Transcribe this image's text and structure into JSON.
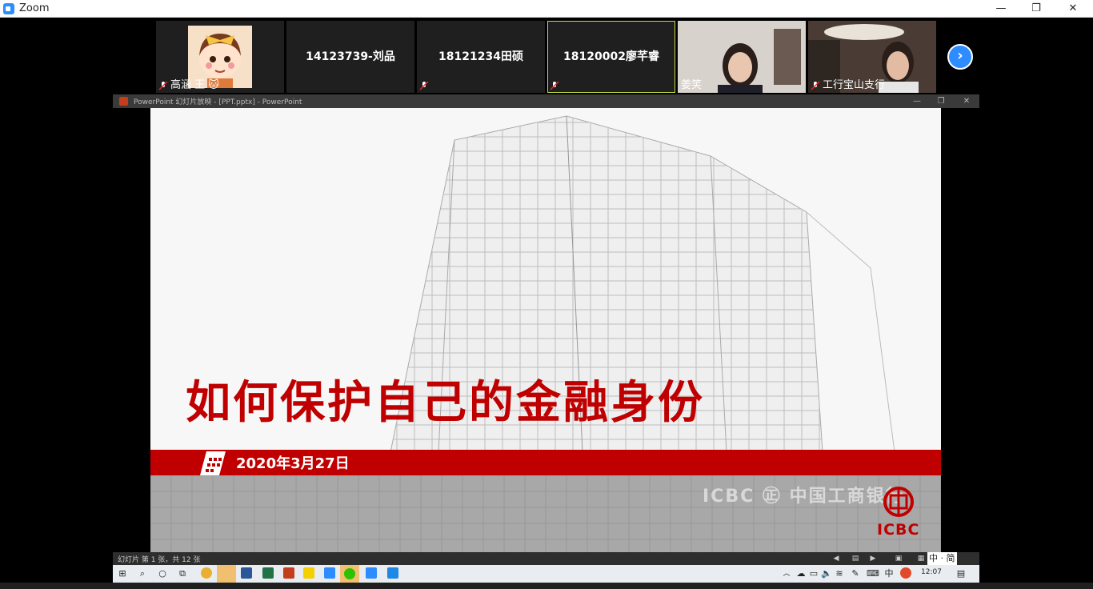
{
  "zoom": {
    "title": "Zoom",
    "min": "—",
    "restore": "❐",
    "close": "✕"
  },
  "gallery": {
    "tiles": [
      {
        "name": "",
        "label": "高涵 王 🐱",
        "muted": true
      },
      {
        "name": "14123739-刘品",
        "label": "",
        "muted": false
      },
      {
        "name": "18121234田硕",
        "label": "",
        "muted": true
      },
      {
        "name": "18120002廖芊睿",
        "label": "",
        "muted": true
      },
      {
        "name": "",
        "label": "姜笑",
        "muted": false
      },
      {
        "name": "",
        "label": "工行宝山支行",
        "muted": true
      }
    ],
    "next": "›"
  },
  "ppt": {
    "window_title": "PowerPoint 幻灯片放映 - [PPT.pptx] - PowerPoint",
    "ctl_min": "—",
    "ctl_restore": "❐",
    "ctl_close": "✕",
    "status": "幻灯片 第 1 张，共 12 张"
  },
  "slide": {
    "title": "如何保护自己的金融身份",
    "date": "2020年3月27日",
    "logo_text": "ICBC",
    "building_sign": "ICBC ㊣ 中国工商银行"
  },
  "taskbar": {
    "ime": "中",
    "time": "12:07",
    "ime2": "中 · 简"
  },
  "colors": {
    "brand_red": "#c00000",
    "zoom_blue": "#2d8cff",
    "active_speaker": "#c6dc46"
  }
}
